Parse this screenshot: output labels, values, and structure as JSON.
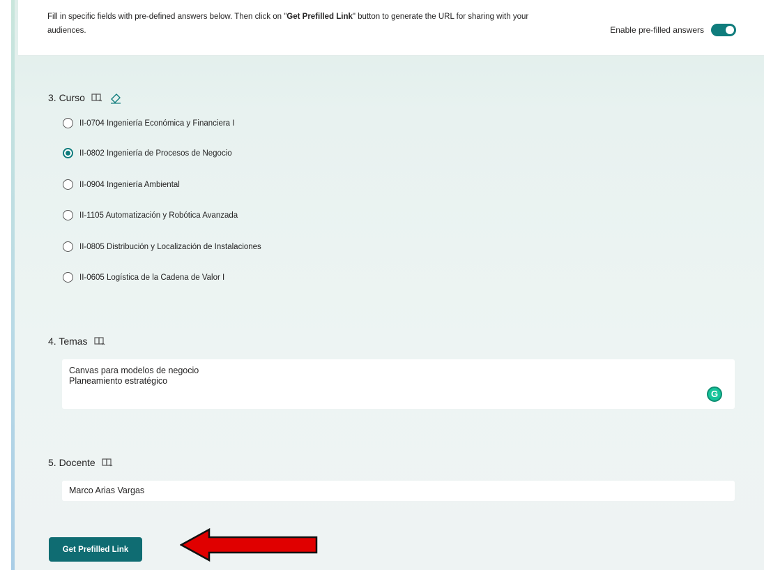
{
  "banner": {
    "text_before": "Fill in specific fields with pre-defined answers below. Then click on \"",
    "text_bold": "Get Prefilled Link",
    "text_after": "\" button to generate the URL for sharing with your audiences.",
    "toggle_label": "Enable pre-filled answers",
    "toggle_on": true
  },
  "questions": {
    "q3": {
      "title": "3. Curso",
      "options": [
        {
          "label": "II-0704 Ingeniería Económica y Financiera I",
          "checked": false
        },
        {
          "label": "II-0802 Ingeniería de Procesos de Negocio",
          "checked": true
        },
        {
          "label": "II-0904 Ingeniería Ambiental",
          "checked": false
        },
        {
          "label": "II-1105 Automatización y Robótica Avanzada",
          "checked": false
        },
        {
          "label": "II-0805 Distribución y Localización de Instalaciones",
          "checked": false
        },
        {
          "label": "II-0605 Logística de la Cadena de Valor I",
          "checked": false
        }
      ]
    },
    "q4": {
      "title": "4. Temas",
      "lines": [
        "Canvas para modelos de negocio",
        "Planeamiento estratégico"
      ]
    },
    "q5": {
      "title": "5. Docente",
      "value": "Marco Arias Vargas"
    }
  },
  "actions": {
    "get_link_label": "Get Prefilled Link"
  },
  "icons": {
    "reader": "immersive-reader-icon",
    "eraser": "eraser-icon",
    "grammarly": "grammarly-icon",
    "arrow": "red-arrow-icon"
  },
  "colors": {
    "accent": "#0f7c7c",
    "button": "#0f6c72",
    "arrow_fill": "#e00000",
    "grammarly": "#15c39a"
  }
}
